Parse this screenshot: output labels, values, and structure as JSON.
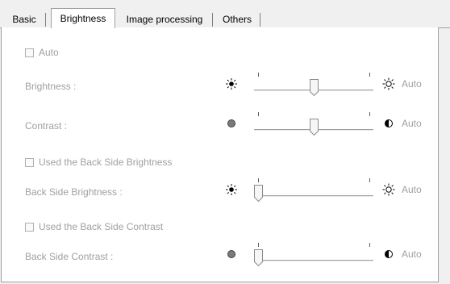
{
  "tabs": [
    {
      "label": "Basic",
      "active": false
    },
    {
      "label": "Brightness",
      "active": true
    },
    {
      "label": "Image processing",
      "active": false
    },
    {
      "label": "Others",
      "active": false
    }
  ],
  "auto_checkbox": {
    "label": "Auto",
    "checked": false
  },
  "brightness": {
    "label": "Brightness :",
    "value_fraction": 0.5,
    "auto_label": "Auto",
    "left_icon": "sun-small-icon",
    "right_icon": "sun-large-icon"
  },
  "contrast": {
    "label": "Contrast :",
    "value_fraction": 0.5,
    "auto_label": "Auto",
    "left_icon": "circle-filled-icon",
    "right_icon": "half-circle-icon"
  },
  "back_brightness_checkbox": {
    "label": "Used the Back Side Brightness",
    "checked": false
  },
  "back_brightness": {
    "label": "Back Side Brightness :",
    "value_fraction": 0.0,
    "auto_label": "Auto",
    "left_icon": "sun-small-icon",
    "right_icon": "sun-large-icon"
  },
  "back_contrast_checkbox": {
    "label": "Used the Back Side Contrast",
    "checked": false
  },
  "back_contrast": {
    "label": "Back Side Contrast :",
    "value_fraction": 0.0,
    "auto_label": "Auto",
    "left_icon": "circle-filled-icon",
    "right_icon": "half-circle-icon"
  },
  "colors": {
    "disabled_text": "#a0a0a0",
    "panel": "#ffffff",
    "window": "#f0f0f0"
  }
}
